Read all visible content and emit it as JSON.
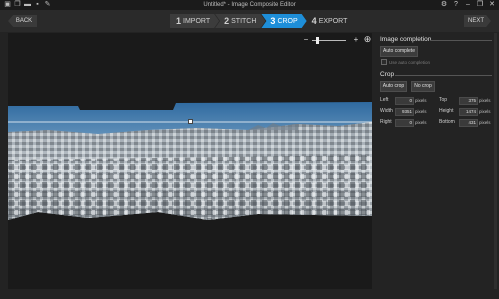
{
  "titlebar": {
    "title": "Untitled* - Image Composite Editor",
    "icons": [
      "new-project-icon",
      "open-icon",
      "folder-icon",
      "save-icon",
      "tools-icon"
    ],
    "controls": {
      "settings": "⚙",
      "help": "?",
      "minimize": "–",
      "restore": "❐",
      "close": "✕"
    }
  },
  "nav": {
    "back_label": "BACK",
    "next_label": "NEXT",
    "steps": [
      {
        "num": "1",
        "label": "IMPORT",
        "active": false
      },
      {
        "num": "2",
        "label": "STITCH",
        "active": false
      },
      {
        "num": "3",
        "label": "CROP",
        "active": true
      },
      {
        "num": "4",
        "label": "EXPORT",
        "active": false
      }
    ]
  },
  "zoom": {
    "minus": "−",
    "plus": "+",
    "fit": "⊕"
  },
  "panel": {
    "image_completion": {
      "title": "Image completion",
      "button": "Auto complete",
      "checkbox_label": "Use auto completion"
    },
    "crop": {
      "title": "Crop",
      "auto_crop": "Auto crop",
      "no_crop": "No crop",
      "fields": {
        "left": {
          "label": "Left",
          "value": "0",
          "unit": "pixels"
        },
        "top": {
          "label": "Top",
          "value": "375",
          "unit": "pixels"
        },
        "width": {
          "label": "Width",
          "value": "9351",
          "unit": "pixels"
        },
        "height": {
          "label": "Height",
          "value": "1474",
          "unit": "pixels"
        },
        "right": {
          "label": "Right",
          "value": "0",
          "unit": "pixels"
        },
        "bottom": {
          "label": "Bottom",
          "value": "431",
          "unit": "pixels"
        }
      }
    }
  },
  "colors": {
    "accent": "#1e8ed8",
    "background": "#232323",
    "panel": "#2a2a2a"
  }
}
